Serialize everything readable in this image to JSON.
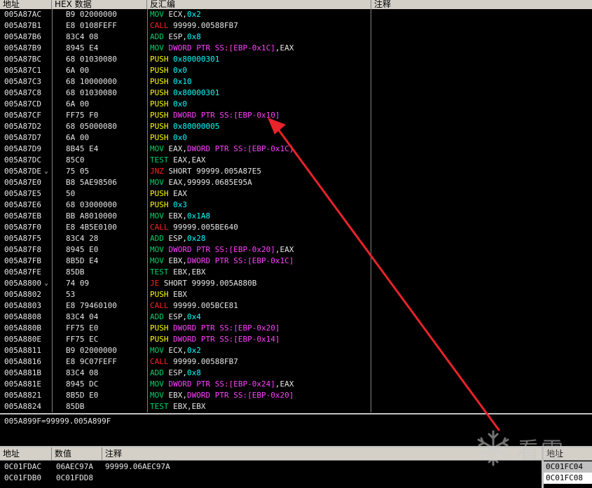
{
  "disasm": {
    "headers": {
      "address": "地址",
      "hex": "HEX 数据",
      "disasm": "反汇编",
      "comment": "注释"
    },
    "rows": [
      {
        "addr": "005A87AC",
        "mark": "",
        "hex": "B9 02000000",
        "segs": [
          {
            "t": "MOV ",
            "c": "mnem"
          },
          {
            "t": "ECX,",
            "c": "op"
          },
          {
            "t": "0x2",
            "c": "imm"
          }
        ]
      },
      {
        "addr": "005A87B1",
        "mark": "",
        "hex": "E8 0108FEFF",
        "segs": [
          {
            "t": "CALL ",
            "c": "call"
          },
          {
            "t": "99999.00588FB7",
            "c": "op"
          }
        ]
      },
      {
        "addr": "005A87B6",
        "mark": "",
        "hex": "83C4 08",
        "segs": [
          {
            "t": "ADD ",
            "c": "mnem"
          },
          {
            "t": "ESP,",
            "c": "op"
          },
          {
            "t": "0x8",
            "c": "imm"
          }
        ]
      },
      {
        "addr": "005A87B9",
        "mark": "",
        "hex": "8945 E4",
        "segs": [
          {
            "t": "MOV ",
            "c": "mnem"
          },
          {
            "t": "DWORD PTR SS:[EBP-0x1C]",
            "c": "mem"
          },
          {
            "t": ",EAX",
            "c": "op"
          }
        ]
      },
      {
        "addr": "005A87BC",
        "mark": "",
        "hex": "68 01030080",
        "segs": [
          {
            "t": "PUSH ",
            "c": "push"
          },
          {
            "t": "0x80000301",
            "c": "imm"
          }
        ]
      },
      {
        "addr": "005A87C1",
        "mark": "",
        "hex": "6A 00",
        "segs": [
          {
            "t": "PUSH ",
            "c": "push"
          },
          {
            "t": "0x0",
            "c": "imm"
          }
        ]
      },
      {
        "addr": "005A87C3",
        "mark": "",
        "hex": "68 10000000",
        "segs": [
          {
            "t": "PUSH ",
            "c": "push"
          },
          {
            "t": "0x10",
            "c": "imm"
          }
        ]
      },
      {
        "addr": "005A87C8",
        "mark": "",
        "hex": "68 01030080",
        "segs": [
          {
            "t": "PUSH ",
            "c": "push"
          },
          {
            "t": "0x80000301",
            "c": "imm"
          }
        ]
      },
      {
        "addr": "005A87CD",
        "mark": "",
        "hex": "6A 00",
        "segs": [
          {
            "t": "PUSH ",
            "c": "push"
          },
          {
            "t": "0x0",
            "c": "imm"
          }
        ]
      },
      {
        "addr": "005A87CF",
        "mark": "",
        "hex": "FF75 F0",
        "segs": [
          {
            "t": "PUSH ",
            "c": "push"
          },
          {
            "t": "DWORD PTR SS:[EBP-0x10]",
            "c": "mem"
          }
        ]
      },
      {
        "addr": "005A87D2",
        "mark": "",
        "hex": "68 05000080",
        "segs": [
          {
            "t": "PUSH ",
            "c": "push"
          },
          {
            "t": "0x80000005",
            "c": "imm"
          }
        ]
      },
      {
        "addr": "005A87D7",
        "mark": "",
        "hex": "6A 00",
        "segs": [
          {
            "t": "PUSH ",
            "c": "push"
          },
          {
            "t": "0x0",
            "c": "imm"
          }
        ]
      },
      {
        "addr": "005A87D9",
        "mark": "",
        "hex": "8B45 E4",
        "segs": [
          {
            "t": "MOV ",
            "c": "mnem"
          },
          {
            "t": "EAX,",
            "c": "op"
          },
          {
            "t": "DWORD PTR SS:[EBP-0x1C]",
            "c": "mem"
          }
        ]
      },
      {
        "addr": "005A87DC",
        "mark": "",
        "hex": "85C0",
        "segs": [
          {
            "t": "TEST ",
            "c": "mnem"
          },
          {
            "t": "EAX,EAX",
            "c": "op"
          }
        ]
      },
      {
        "addr": "005A87DE",
        "mark": "⌄",
        "hex": "75 05",
        "segs": [
          {
            "t": "JNZ ",
            "c": "jmp"
          },
          {
            "t": "SHORT 99999.005A87E5",
            "c": "op"
          }
        ]
      },
      {
        "addr": "005A87E0",
        "mark": "",
        "hex": "B8 5AE98506",
        "segs": [
          {
            "t": "MOV ",
            "c": "mnem"
          },
          {
            "t": "EAX,99999.0685E95A",
            "c": "op"
          }
        ]
      },
      {
        "addr": "005A87E5",
        "mark": "",
        "hex": "50",
        "segs": [
          {
            "t": "PUSH ",
            "c": "push"
          },
          {
            "t": "EAX",
            "c": "op"
          }
        ]
      },
      {
        "addr": "005A87E6",
        "mark": "",
        "hex": "68 03000000",
        "segs": [
          {
            "t": "PUSH ",
            "c": "push"
          },
          {
            "t": "0x3",
            "c": "imm"
          }
        ]
      },
      {
        "addr": "005A87EB",
        "mark": "",
        "hex": "BB A8010000",
        "segs": [
          {
            "t": "MOV ",
            "c": "mnem"
          },
          {
            "t": "EBX,",
            "c": "op"
          },
          {
            "t": "0x1A8",
            "c": "imm"
          }
        ]
      },
      {
        "addr": "005A87F0",
        "mark": "",
        "hex": "E8 4B5E0100",
        "segs": [
          {
            "t": "CALL ",
            "c": "call"
          },
          {
            "t": "99999.005BE640",
            "c": "op"
          }
        ]
      },
      {
        "addr": "005A87F5",
        "mark": "",
        "hex": "83C4 28",
        "segs": [
          {
            "t": "ADD ",
            "c": "mnem"
          },
          {
            "t": "ESP,",
            "c": "op"
          },
          {
            "t": "0x28",
            "c": "imm"
          }
        ]
      },
      {
        "addr": "005A87F8",
        "mark": "",
        "hex": "8945 E0",
        "segs": [
          {
            "t": "MOV ",
            "c": "mnem"
          },
          {
            "t": "DWORD PTR SS:[EBP-0x20]",
            "c": "mem"
          },
          {
            "t": ",EAX",
            "c": "op"
          }
        ]
      },
      {
        "addr": "005A87FB",
        "mark": "",
        "hex": "8B5D E4",
        "segs": [
          {
            "t": "MOV ",
            "c": "mnem"
          },
          {
            "t": "EBX,",
            "c": "op"
          },
          {
            "t": "DWORD PTR SS:[EBP-0x1C]",
            "c": "mem"
          }
        ]
      },
      {
        "addr": "005A87FE",
        "mark": "",
        "hex": "85DB",
        "segs": [
          {
            "t": "TEST ",
            "c": "mnem"
          },
          {
            "t": "EBX,EBX",
            "c": "op"
          }
        ]
      },
      {
        "addr": "005A8800",
        "mark": "⌄",
        "hex": "74 09",
        "segs": [
          {
            "t": "JE ",
            "c": "jmp"
          },
          {
            "t": "SHORT 99999.005A880B",
            "c": "op"
          }
        ]
      },
      {
        "addr": "005A8802",
        "mark": "",
        "hex": "53",
        "segs": [
          {
            "t": "PUSH ",
            "c": "push"
          },
          {
            "t": "EBX",
            "c": "op"
          }
        ]
      },
      {
        "addr": "005A8803",
        "mark": "",
        "hex": "E8 79460100",
        "segs": [
          {
            "t": "CALL ",
            "c": "call"
          },
          {
            "t": "99999.005BCE81",
            "c": "op"
          }
        ]
      },
      {
        "addr": "005A8808",
        "mark": "",
        "hex": "83C4 04",
        "segs": [
          {
            "t": "ADD ",
            "c": "mnem"
          },
          {
            "t": "ESP,",
            "c": "op"
          },
          {
            "t": "0x4",
            "c": "imm"
          }
        ]
      },
      {
        "addr": "005A880B",
        "mark": "",
        "hex": "FF75 E0",
        "segs": [
          {
            "t": "PUSH ",
            "c": "push"
          },
          {
            "t": "DWORD PTR SS:[EBP-0x20]",
            "c": "mem"
          }
        ]
      },
      {
        "addr": "005A880E",
        "mark": "",
        "hex": "FF75 EC",
        "segs": [
          {
            "t": "PUSH ",
            "c": "push"
          },
          {
            "t": "DWORD PTR SS:[EBP-0x14]",
            "c": "mem"
          }
        ]
      },
      {
        "addr": "005A8811",
        "mark": "",
        "hex": "B9 02000000",
        "segs": [
          {
            "t": "MOV ",
            "c": "mnem"
          },
          {
            "t": "ECX,",
            "c": "op"
          },
          {
            "t": "0x2",
            "c": "imm"
          }
        ]
      },
      {
        "addr": "005A8816",
        "mark": "",
        "hex": "E8 9C07FEFF",
        "segs": [
          {
            "t": "CALL ",
            "c": "call"
          },
          {
            "t": "99999.00588FB7",
            "c": "op"
          }
        ]
      },
      {
        "addr": "005A881B",
        "mark": "",
        "hex": "83C4 08",
        "segs": [
          {
            "t": "ADD ",
            "c": "mnem"
          },
          {
            "t": "ESP,",
            "c": "op"
          },
          {
            "t": "0x8",
            "c": "imm"
          }
        ]
      },
      {
        "addr": "005A881E",
        "mark": "",
        "hex": "8945 DC",
        "segs": [
          {
            "t": "MOV ",
            "c": "mnem"
          },
          {
            "t": "DWORD PTR SS:[EBP-0x24]",
            "c": "mem"
          },
          {
            "t": ",EAX",
            "c": "op"
          }
        ]
      },
      {
        "addr": "005A8821",
        "mark": "",
        "hex": "8B5D E0",
        "segs": [
          {
            "t": "MOV ",
            "c": "mnem"
          },
          {
            "t": "EBX,",
            "c": "op"
          },
          {
            "t": "DWORD PTR SS:[EBP-0x20]",
            "c": "mem"
          }
        ]
      },
      {
        "addr": "005A8824",
        "mark": "",
        "hex": "85DB",
        "segs": [
          {
            "t": "TEST ",
            "c": "mnem"
          },
          {
            "t": "EBX,EBX",
            "c": "op"
          }
        ]
      }
    ]
  },
  "info": {
    "text": "005A899F=99999.005A899F"
  },
  "dump": {
    "headers": {
      "address": "地址",
      "value": "数值",
      "comment": "注释"
    },
    "rows": [
      {
        "addr": "0C01FDAC",
        "value": "06AEC97A",
        "comment": "99999.06AEC97A"
      },
      {
        "addr": "0C01FDB0",
        "value": "0C01FDD8",
        "comment": ""
      }
    ]
  },
  "stack": {
    "header": "地址",
    "rows": [
      "0C01FC04",
      "0C01FC08"
    ]
  },
  "watermark": {
    "text": "看雪",
    "icon": "snowflake-icon"
  },
  "colors": {
    "mnem": "#00d26a",
    "push": "#ffff00",
    "call": "#ff2020",
    "jmp": "#ff2020",
    "imm": "#00ffff",
    "mem": "#ff40ff",
    "op": "#e6e6e6",
    "arrow": "#e8232a"
  }
}
